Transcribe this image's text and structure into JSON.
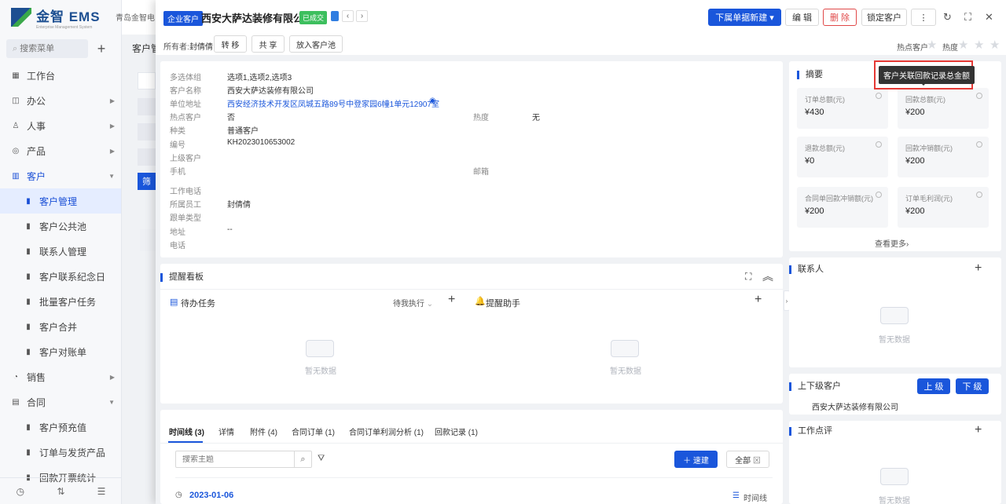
{
  "app": {
    "brand": "金智 EMS",
    "brand_sub": "Enterprise Management System",
    "company": "青岛金智电子"
  },
  "sidebar": {
    "search_placeholder": "搜索菜单",
    "items": [
      {
        "label": "工作台",
        "icon": "dashboard-icon"
      },
      {
        "label": "办公",
        "icon": "office-icon"
      },
      {
        "label": "人事",
        "icon": "people-icon"
      },
      {
        "label": "产品",
        "icon": "product-icon"
      },
      {
        "label": "客户",
        "icon": "customer-icon"
      }
    ],
    "sub_items": [
      "客户管理",
      "客户公共池",
      "联系人管理",
      "客户联系纪念日",
      "批量客户任务",
      "客户合并",
      "客户对账单"
    ],
    "items_after": [
      "销售",
      "合同"
    ],
    "contract_sub": [
      "客户预充值",
      "订单与发货产品",
      "回款开票统计"
    ]
  },
  "bg": {
    "tab_label": "客户管",
    "filter_btn": "筛"
  },
  "header": {
    "type_badge": "企业客户",
    "customer_name": "西安大萨达装修有限公司",
    "status_badge": "已成交",
    "owner_label": "所有者:",
    "owner_name": "封倩倩",
    "transfer_btn": "转 移",
    "share_btn": "共 享",
    "pool_btn": "放入客户池",
    "new_btn": "下属单据新建",
    "edit_btn": "编 辑",
    "delete_btn": "删 除",
    "lock_btn": "锁定客户",
    "hot_customer_label": "热点客户",
    "heat_label": "热度"
  },
  "fields": [
    {
      "label": "多选体组",
      "value": "选项1,选项2,选项3"
    },
    {
      "label": "客户名称",
      "value": "西安大萨达装修有限公司"
    },
    {
      "label": "单位地址",
      "value": "西安经济技术开发区凤城五路89号中登家园6幢1单元12907室"
    },
    {
      "label": "热点客户",
      "value": "否"
    },
    {
      "label": "种类",
      "value": "普通客户"
    },
    {
      "label": "编号",
      "value": "KH2023010653002"
    },
    {
      "label": "上级客户",
      "value": ""
    },
    {
      "label": "手机",
      "value": ""
    },
    {
      "label": "工作电话",
      "value": ""
    },
    {
      "label": "所属员工",
      "value": "封倩倩"
    },
    {
      "label": "跟单类型",
      "value": ""
    },
    {
      "label": "地址",
      "value": "--"
    },
    {
      "label": "电话",
      "value": ""
    }
  ],
  "fields_right": [
    {
      "label": "热度",
      "value": "无"
    },
    {
      "label": "邮箱",
      "value": ""
    }
  ],
  "remind": {
    "title": "提醒看板",
    "todo": "待办任务",
    "filter": "待我执行",
    "assistant": "提醒助手",
    "empty": "暂无数据"
  },
  "timeline": {
    "tabs": [
      "时间线 (3)",
      "详情",
      "附件 (4)",
      "合同订单 (1)",
      "合同订单利润分析 (1)",
      "回款记录 (1)"
    ],
    "search_placeholder": "搜索主题",
    "new_btn": "速建",
    "all_btn": "全部",
    "date": "2023-01-06",
    "view_label": "时间线"
  },
  "summary": {
    "title": "摘要",
    "items": [
      {
        "label": "订单总额(元)",
        "value": "¥430"
      },
      {
        "label": "回款总额(元)",
        "value": "¥200"
      },
      {
        "label": "退款总额(元)",
        "value": "¥0"
      },
      {
        "label": "回款冲销额(元)",
        "value": "¥200"
      },
      {
        "label": "合同单回款冲销额(元)",
        "value": "¥200"
      },
      {
        "label": "订单毛利润(元)",
        "value": "¥200"
      }
    ],
    "more": "查看更多"
  },
  "tooltip": "客户关联回款记录总金额",
  "contacts": {
    "title": "联系人",
    "empty": "暂无数据"
  },
  "hierarchy": {
    "title": "上下级客户",
    "up_btn": "上 级",
    "down_btn": "下 级",
    "company": "西安大萨达装修有限公司"
  },
  "review": {
    "title": "工作点评",
    "empty": "暂无数据"
  }
}
